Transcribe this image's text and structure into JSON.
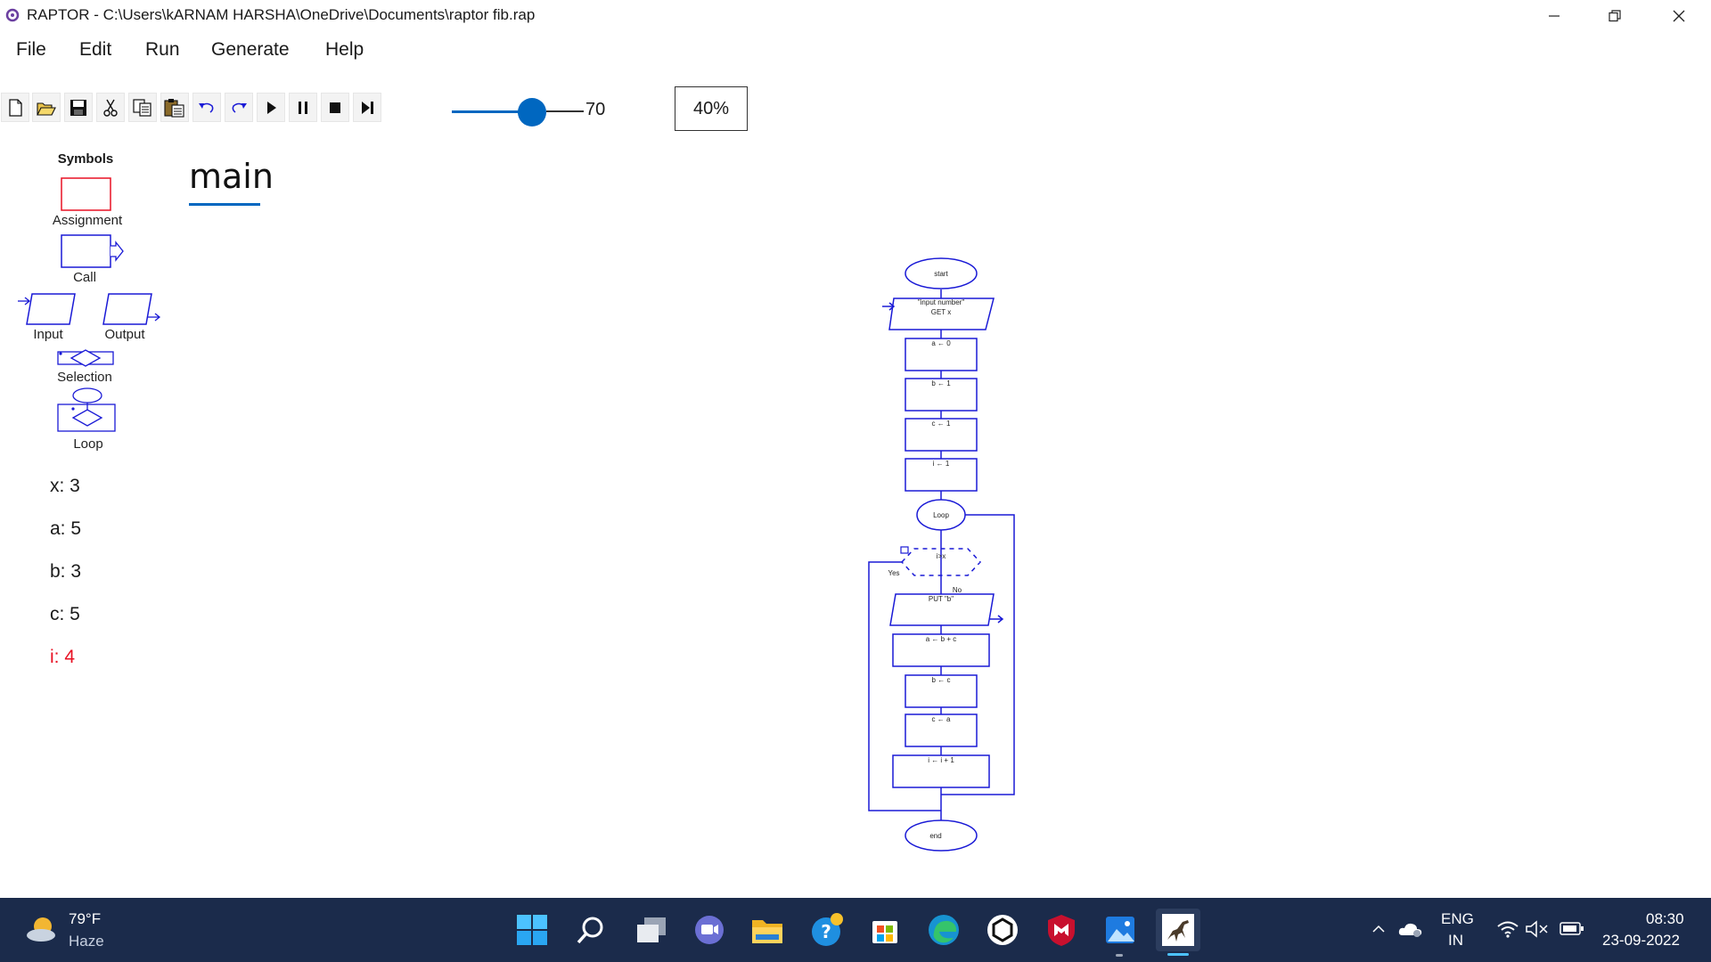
{
  "window": {
    "title": "RAPTOR - C:\\Users\\kARNAM HARSHA\\OneDrive\\Documents\\raptor fib.rap"
  },
  "menu": [
    "File",
    "Edit",
    "Run",
    "Generate",
    "Help"
  ],
  "toolbar": {
    "buttons": [
      "new-icon",
      "open-icon",
      "save-icon",
      "cut-icon",
      "copy-icon",
      "paste-icon",
      "undo-icon",
      "redo-icon",
      "play-icon",
      "pause-icon",
      "stop-icon",
      "step-icon"
    ],
    "speed_value": "70",
    "speed_fraction": 0.7,
    "zoom": "40%"
  },
  "symbols": {
    "heading": "Symbols",
    "assignment": "Assignment",
    "call": "Call",
    "input": "Input",
    "output": "Output",
    "selection": "Selection",
    "loop": "Loop"
  },
  "variables": [
    "x: 3",
    "a: 5",
    "b: 3",
    "c: 5",
    "i: 4"
  ],
  "tab": {
    "label": "main"
  },
  "flowchart": {
    "start": "start",
    "input_prompt": "\"input number\"",
    "input_get": "GET x",
    "assign_a": "a ← 0",
    "assign_b": "b ← 1",
    "assign_c": "c ← 1",
    "assign_i": "i ← 1",
    "loop": "Loop",
    "condition": "i>x",
    "yes": "Yes",
    "no": "No",
    "output": "PUT \"b\"",
    "body1": "a ← b + c",
    "body2": "b ← c",
    "body3": "c ← a",
    "body4": "i ← i + 1",
    "end": "end"
  },
  "colors": {
    "accent": "#0067c0",
    "flow": "#1a1ad6",
    "active_var": "#e81123",
    "taskbar": "#1b2b4b"
  },
  "taskbar": {
    "weather_temp": "79°F",
    "weather_desc": "Haze",
    "lang_top": "ENG",
    "lang_bottom": "IN",
    "time": "08:30",
    "date": "23-09-2022"
  }
}
